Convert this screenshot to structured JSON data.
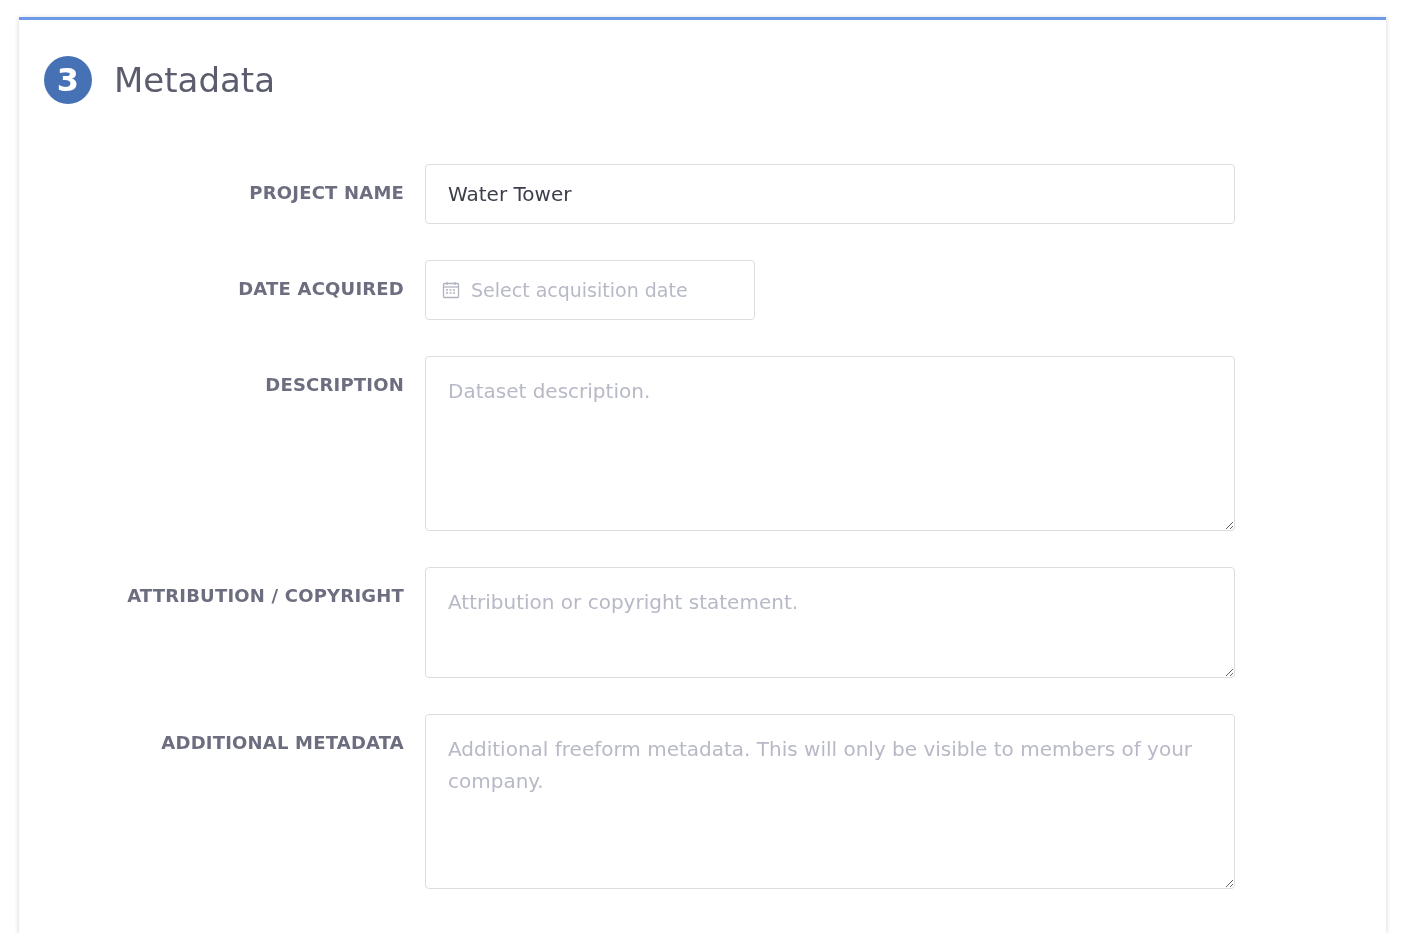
{
  "section": {
    "step": "3",
    "title": "Metadata"
  },
  "fields": [
    {
      "label": "PROJECT NAME",
      "kind": "text",
      "value": "Water Tower"
    },
    {
      "label": "DATE ACQUIRED",
      "kind": "date",
      "placeholder": "Select acquisition date"
    },
    {
      "label": "DESCRIPTION",
      "kind": "textarea",
      "placeholder": "Dataset description."
    },
    {
      "label": "ATTRIBUTION / COPYRIGHT",
      "kind": "textarea-short",
      "placeholder": "Attribution or copyright statement."
    },
    {
      "label": "ADDITIONAL METADATA",
      "kind": "textarea",
      "placeholder": "Additional freeform metadata. This will only be visible to members of your company."
    }
  ]
}
